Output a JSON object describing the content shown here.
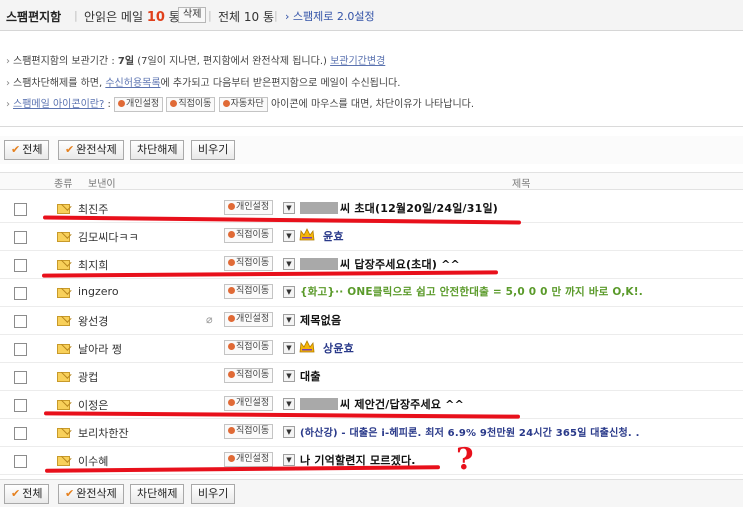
{
  "topbar": {
    "title": "스팸편지함",
    "unread_prefix": "안읽은 메일",
    "unread_count": "10",
    "unread_suffix": "통",
    "delete_button": "삭제",
    "total": "전체 10 통",
    "settings_link": "› 스팸제로 2.0설정"
  },
  "notices": {
    "line1": {
      "pre": "스팸편지함의 보관기간 : ",
      "bold": "7일",
      "mid": " (7일이 지나면, 편지함에서 완전삭제 됩니다.) ",
      "link": "보관기간변경"
    },
    "line2": {
      "pre": "스팸차단해제를 하면, ",
      "link": "수신허용목록",
      "post": "에 추가되고 다음부터 받은편지함으로 메일이 수신됩니다."
    },
    "line3": {
      "link": "스팸메일 아이콘이란?",
      "sep": " : ",
      "tag1": "개인설정",
      "tag2": "직접이동",
      "tag3": "자동차단",
      "post": " 아이콘에 마우스를 대면, 차단이유가 나타납니다."
    }
  },
  "toolbar": {
    "all": "전체",
    "delete_all": "완전삭제",
    "unblock": "차단해제",
    "empty": "비우기"
  },
  "columns": {
    "type": "종류",
    "sender": "보낸이",
    "subject": "제목"
  },
  "rows": [
    {
      "sender": "최진주",
      "tag": "개인설정",
      "subject": "씨 초대(12월20일/24일/31일)",
      "color": "#111111"
    },
    {
      "sender": "김모씨다ㅋㅋ",
      "tag": "직접이동",
      "subject": "윤효",
      "color": "#2a3a8a"
    },
    {
      "sender": "최지희",
      "tag": "직접이동",
      "subject": "씨 답장주세요(초대) ^^",
      "color": "#111111"
    },
    {
      "sender": "ingzero",
      "tag": "직접이동",
      "subject": "{화고}·· ONE클릭으로 쉽고 안전한대출 = 5,0 0 0 만 까지 바로 O,K!.",
      "color": "#5a9a2a"
    },
    {
      "sender": "왕선경",
      "tag": "개인설정",
      "subject": "제목없음",
      "color": "#111111"
    },
    {
      "sender": "날아라 쩡",
      "tag": "직접이동",
      "subject": "상윤효",
      "color": "#2a3a8a"
    },
    {
      "sender": "광컵",
      "tag": "직접이동",
      "subject": "대출",
      "color": "#111111"
    },
    {
      "sender": "이정은",
      "tag": "개인설정",
      "subject": "씨 제안건/답장주세요 ^^",
      "color": "#111111"
    },
    {
      "sender": "보리차한잔",
      "tag": "직접이동",
      "subject": "(하산강) - 대출은 i-헤피론. 최저 6.9% 9천만원 24시간 365일 대출신청. .",
      "color": "#2a3a8a"
    },
    {
      "sender": "이수혜",
      "tag": "개인설정",
      "subject": "나 기억할련지 모르겠다.",
      "color": "#111111"
    }
  ],
  "accent_color": "#e8101b"
}
